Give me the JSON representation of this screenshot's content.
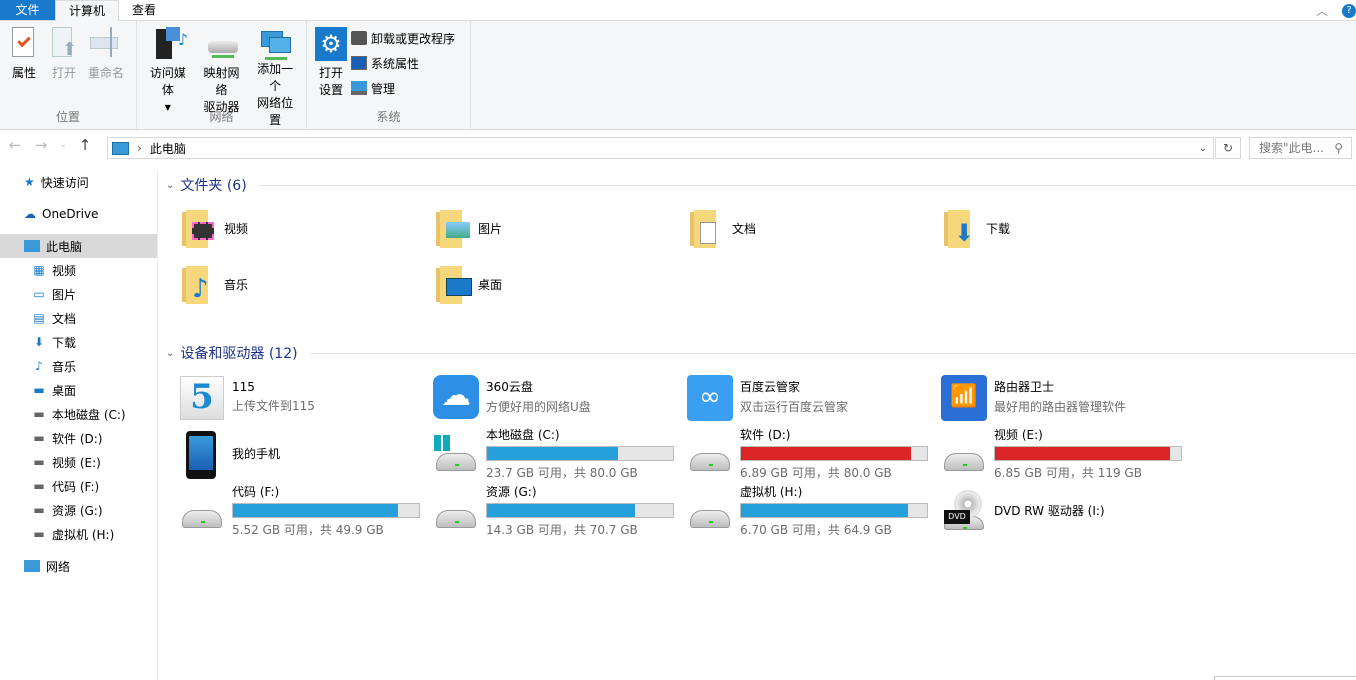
{
  "tabs": {
    "file": "文件",
    "computer": "计算机",
    "view": "查看"
  },
  "ribbon": {
    "location": {
      "label": "位置",
      "properties": "属性",
      "open": "打开",
      "rename": "重命名"
    },
    "network": {
      "label": "网络",
      "access_media": "访问媒体",
      "map_drive_1": "映射网络",
      "map_drive_2": "驱动器",
      "add_location_1": "添加一个",
      "add_location_2": "网络位置"
    },
    "system": {
      "label": "系统",
      "open_settings_1": "打开",
      "open_settings_2": "设置",
      "uninstall": "卸载或更改程序",
      "sys_props": "系统属性",
      "manage": "管理"
    }
  },
  "address": {
    "path": "此电脑",
    "search_placeholder": "搜索\"此电..."
  },
  "sidebar": {
    "quick_access": "快速访问",
    "onedrive": "OneDrive",
    "this_pc": "此电脑",
    "children": [
      "视频",
      "图片",
      "文档",
      "下载",
      "音乐",
      "桌面",
      "本地磁盘 (C:)",
      "软件 (D:)",
      "视频 (E:)",
      "代码 (F:)",
      "资源 (G:)",
      "虚拟机 (H:)"
    ],
    "network": "网络"
  },
  "folders": {
    "header": "文件夹 (6)",
    "items": [
      "视频",
      "图片",
      "文档",
      "下载",
      "音乐",
      "桌面"
    ]
  },
  "devices": {
    "header": "设备和驱动器 (12)",
    "apps": [
      {
        "name": "115",
        "desc": "上传文件到115"
      },
      {
        "name": "360云盘",
        "desc": "方便好用的网络U盘"
      },
      {
        "name": "百度云管家",
        "desc": "双击运行百度云管家"
      },
      {
        "name": "路由器卫士",
        "desc": "最好用的路由器管理软件"
      }
    ],
    "phone": "我的手机",
    "drives": [
      {
        "name": "本地磁盘 (C:)",
        "info": "23.7 GB 可用，共 80.0 GB",
        "used_pct": 70.4,
        "color": "#26a0da"
      },
      {
        "name": "软件 (D:)",
        "info": "6.89 GB 可用，共 80.0 GB",
        "used_pct": 91.4,
        "color": "#da2626"
      },
      {
        "name": "视频 (E:)",
        "info": "6.85 GB 可用，共 119 GB",
        "used_pct": 94.2,
        "color": "#da2626"
      },
      {
        "name": "代码 (F:)",
        "info": "5.52 GB 可用，共 49.9 GB",
        "used_pct": 88.9,
        "color": "#26a0da"
      },
      {
        "name": "资源 (G:)",
        "info": "14.3 GB 可用，共 70.7 GB",
        "used_pct": 79.8,
        "color": "#26a0da"
      },
      {
        "name": "虚拟机 (H:)",
        "info": "6.70 GB 可用，共 64.9 GB",
        "used_pct": 89.7,
        "color": "#26a0da"
      }
    ],
    "dvd": "DVD RW 驱动器 (I:)"
  }
}
